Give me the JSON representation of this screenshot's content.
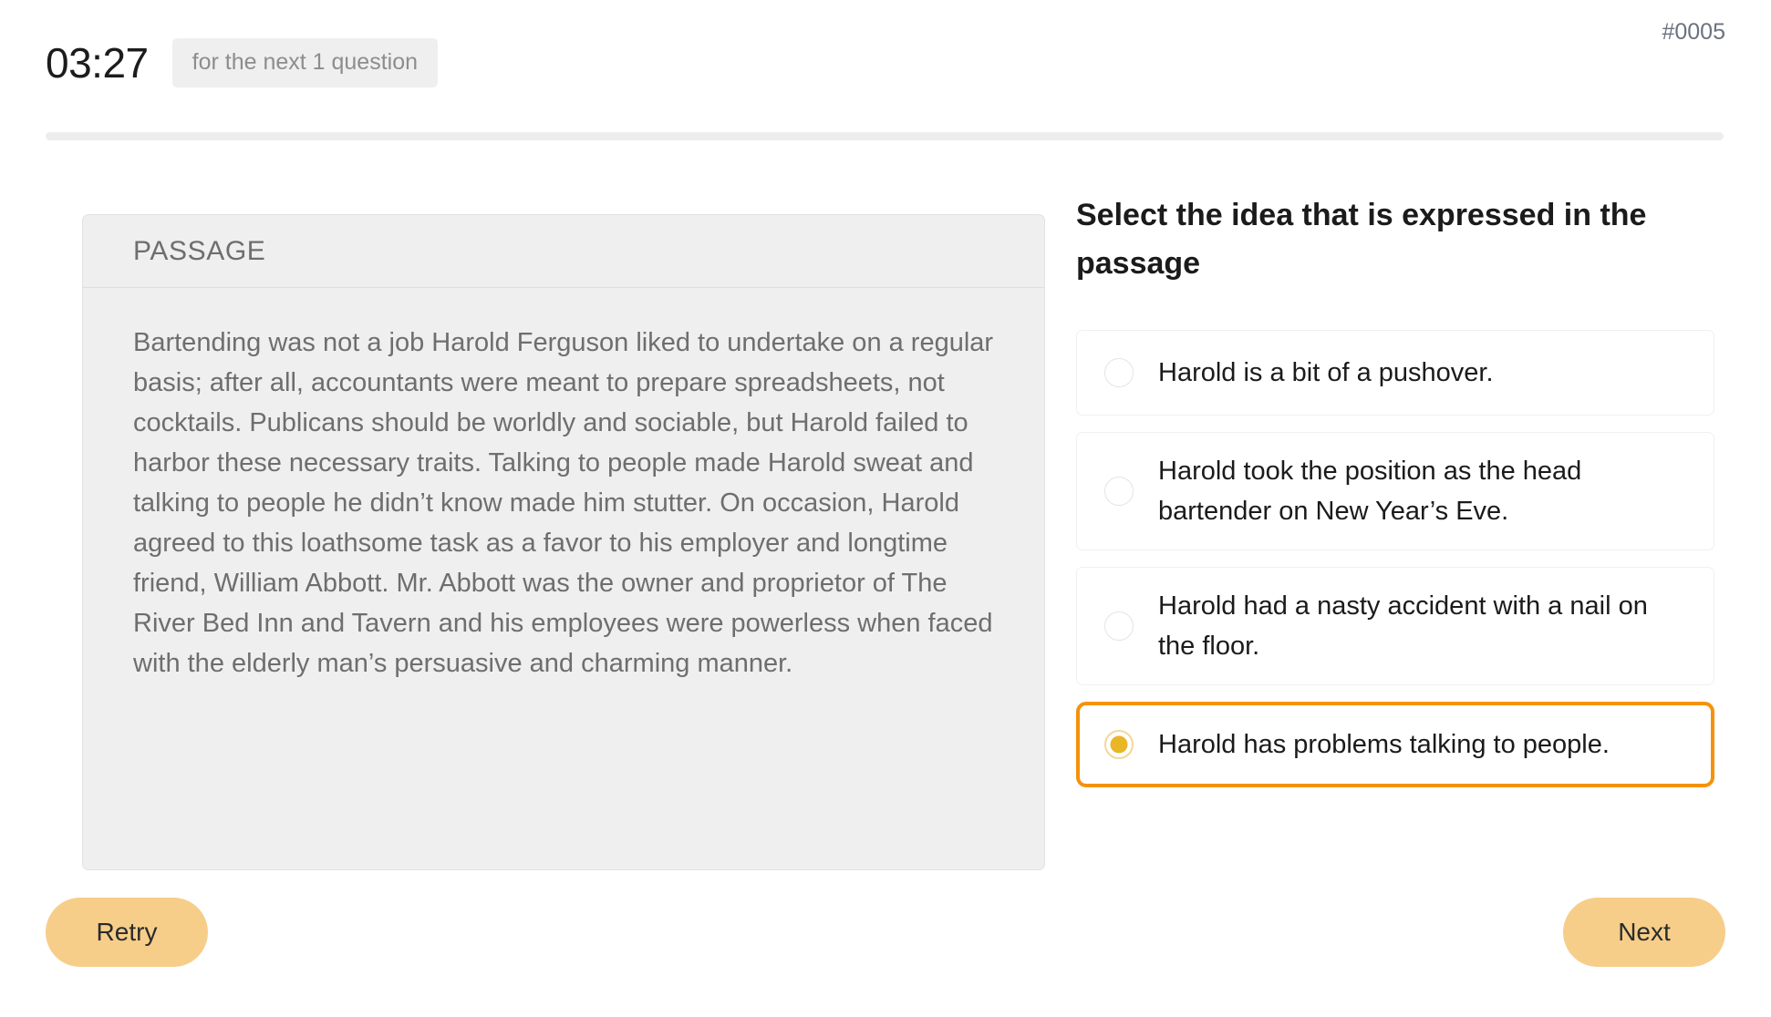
{
  "header": {
    "timer": "03:27",
    "timer_note": "for the next 1 question",
    "question_id": "#0005",
    "progress_percent": 0
  },
  "passage": {
    "title": "PASSAGE",
    "text": "Bartending was not a job Harold Ferguson liked to undertake on a regular basis; after all, accountants were meant to prepare spreadsheets, not cocktails. Publicans should be worldly and sociable, but Harold failed to harbor these necessary traits. Talking to people made Harold sweat and talking to people he didn’t know made him stutter. On occasion, Harold agreed to this loathsome task as a favor to his employer and longtime friend, William Abbott. Mr. Abbott was the owner and proprietor of The River Bed Inn and Tavern and his employees were powerless when faced with the elderly man’s persuasive and charming manner."
  },
  "question": {
    "heading": "Select the idea that is expressed in the passage",
    "options": [
      {
        "label": "Harold is a bit of a pushover.",
        "selected": false
      },
      {
        "label": "Harold took the position as the head bartender on New Year’s Eve.",
        "selected": false
      },
      {
        "label": "Harold had a nasty accident with a nail on the floor.",
        "selected": false
      },
      {
        "label": "Harold has problems talking to people.",
        "selected": true
      }
    ]
  },
  "footer": {
    "retry_label": "Retry",
    "next_label": "Next"
  },
  "colors": {
    "accent_orange": "#f5920b",
    "button_amber": "#f6ce8a",
    "radio_fill": "#e9b726",
    "badge_bg": "#efefef",
    "passage_bg": "#efefef"
  }
}
